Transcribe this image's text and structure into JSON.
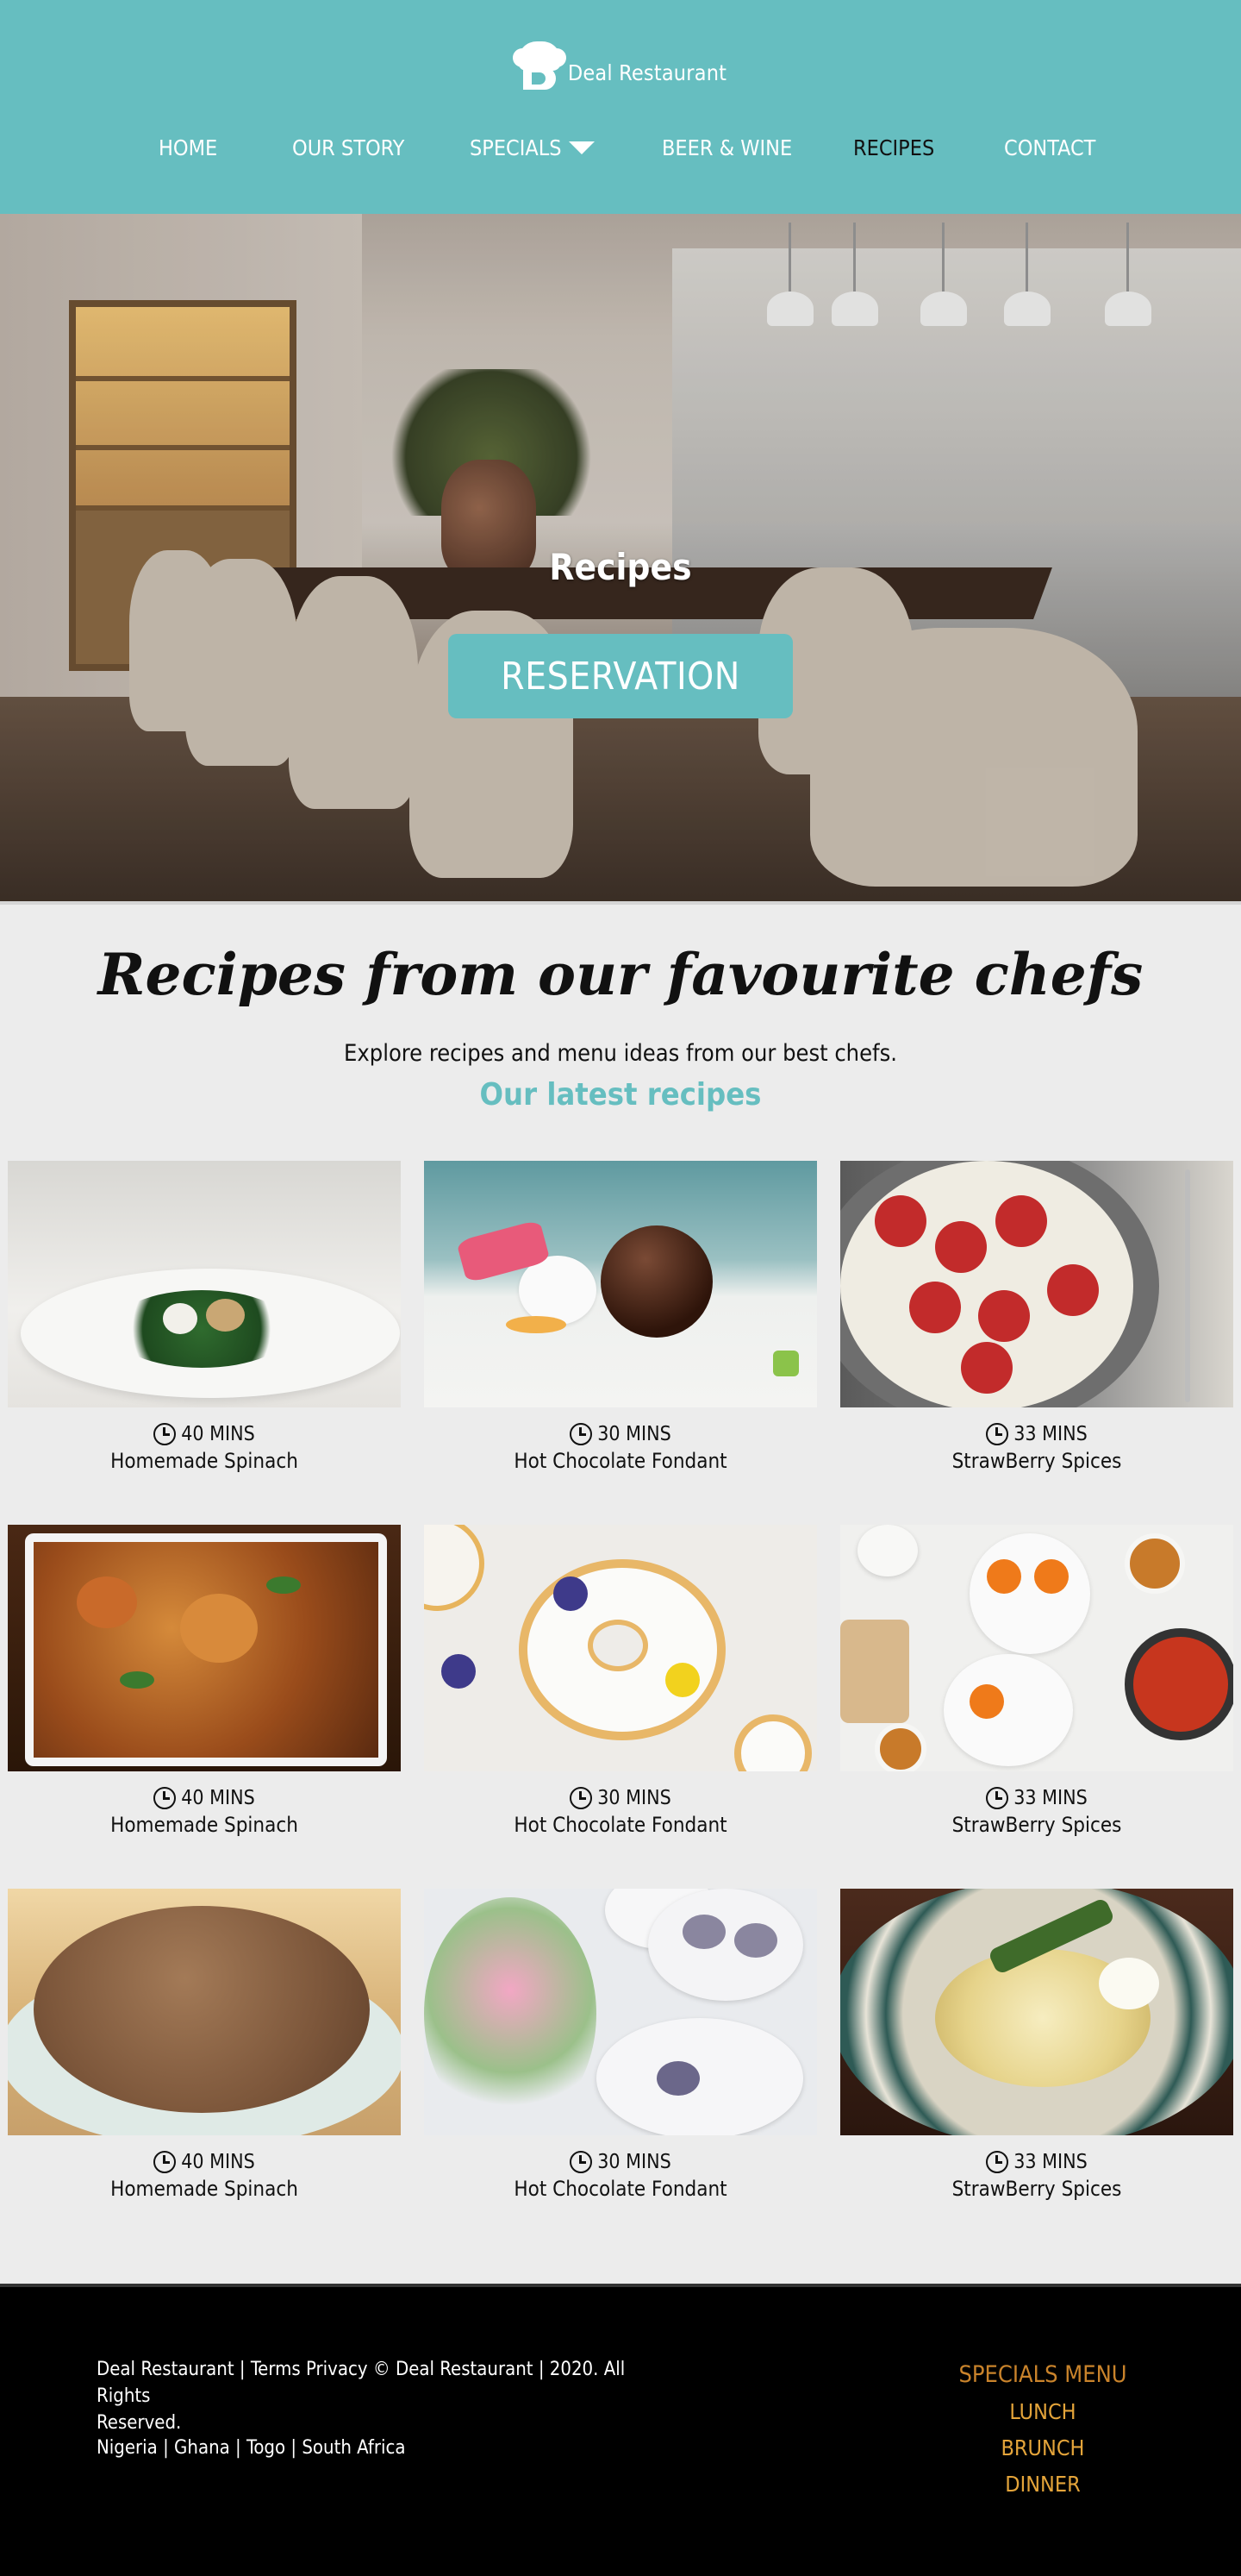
{
  "brand": {
    "name": "Deal Restaurant"
  },
  "nav": {
    "items": [
      {
        "label": "HOME"
      },
      {
        "label": "OUR STORY"
      },
      {
        "label": "SPECIALS"
      },
      {
        "label": "BEER & WINE"
      },
      {
        "label": "RECIPES"
      },
      {
        "label": "CONTACT"
      }
    ],
    "active": "RECIPES"
  },
  "hero": {
    "title": "Recipes",
    "button_label": "RESERVATION"
  },
  "main": {
    "title": "Recipes from our favourite chefs",
    "intro": "Explore recipes and menu ideas from our best chefs.",
    "subtitle": "Our latest recipes"
  },
  "recipes": [
    {
      "time": "40 MINS",
      "name": "Homemade Spinach"
    },
    {
      "time": "30 MINS",
      "name": "Hot Chocolate Fondant"
    },
    {
      "time": "33 MINS",
      "name": "StrawBerry Spices"
    },
    {
      "time": "40 MINS",
      "name": "Homemade Spinach"
    },
    {
      "time": "30 MINS",
      "name": "Hot Chocolate Fondant"
    },
    {
      "time": "33 MINS",
      "name": "StrawBerry Spices"
    },
    {
      "time": "40 MINS",
      "name": "Homemade Spinach"
    },
    {
      "time": "30 MINS",
      "name": "Hot Chocolate Fondant"
    },
    {
      "time": "33 MINS",
      "name": "StrawBerry Spices"
    }
  ],
  "footer": {
    "legal_line1": "Deal Restaurant  | Terms Privacy © Deal Restaurant  |  2020. All Rights",
    "legal_line2": "Reserved.",
    "countries": "Nigeria | Ghana | Togo | South Africa",
    "menu_title": "SPECIALS MENU",
    "menu_items": [
      "LUNCH",
      "BRUNCH",
      "DINNER"
    ]
  },
  "colors": {
    "accent": "#66bec0",
    "footer_bg": "#000000",
    "footer_menu_title": "#c9832b",
    "footer_menu_item": "#e4a43a"
  }
}
